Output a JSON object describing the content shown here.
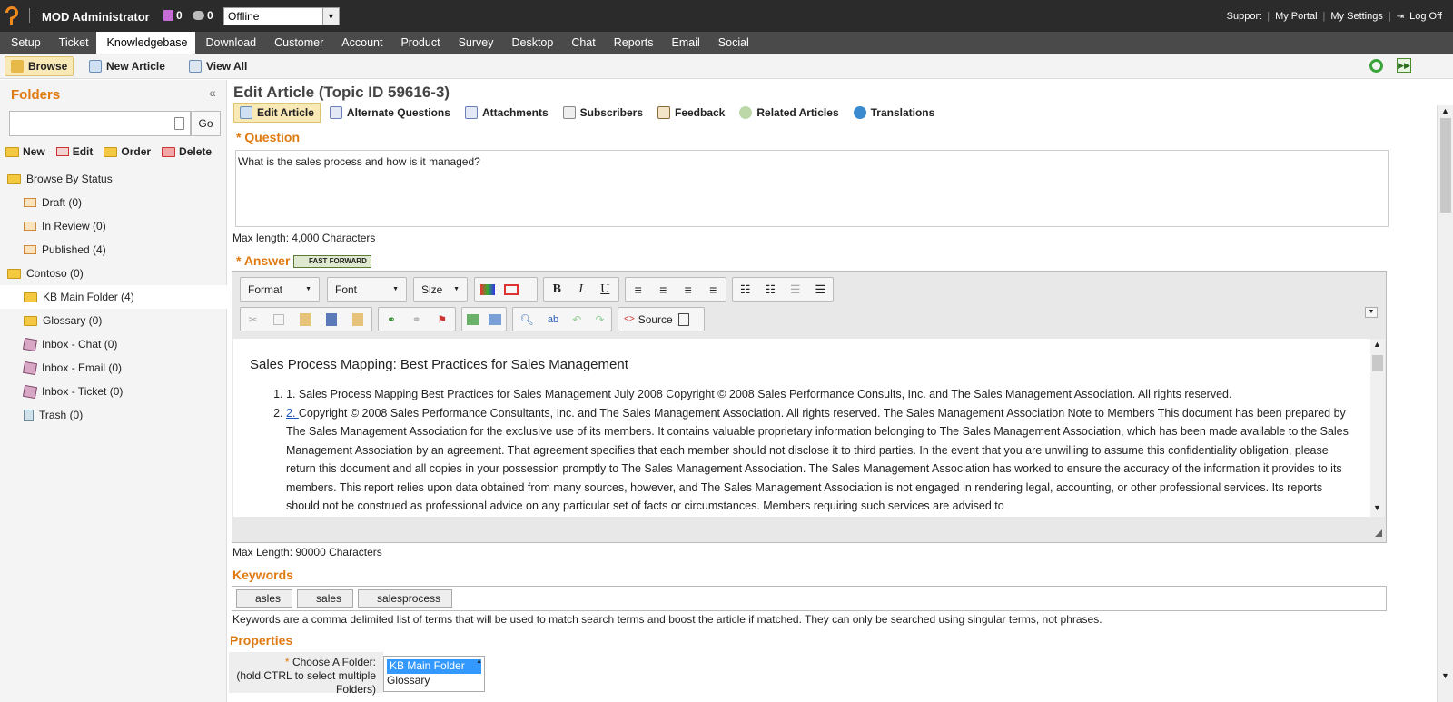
{
  "topbar": {
    "user": "MOD Administrator",
    "count1": "0",
    "count2": "0",
    "status": "Offline",
    "links": [
      "Support",
      "My Portal",
      "My Settings",
      "Log Off"
    ]
  },
  "nav": [
    "Setup",
    "Ticket",
    "Knowledgebase",
    "Download",
    "Customer",
    "Account",
    "Product",
    "Survey",
    "Desktop",
    "Chat",
    "Reports",
    "Email",
    "Social"
  ],
  "subbar": {
    "browse": "Browse",
    "new_article": "New Article",
    "view_all": "View All"
  },
  "sidebar": {
    "title": "Folders",
    "go": "Go",
    "actions": [
      "New",
      "Edit",
      "Order",
      "Delete"
    ],
    "tree": [
      {
        "label": "Browse By Status",
        "indent": 0,
        "icon": "folder"
      },
      {
        "label": "Draft (0)",
        "indent": 1,
        "icon": "doc"
      },
      {
        "label": "In Review (0)",
        "indent": 1,
        "icon": "doc"
      },
      {
        "label": "Published (4)",
        "indent": 1,
        "icon": "doc"
      },
      {
        "label": "Contoso (0)",
        "indent": 0,
        "icon": "folder"
      },
      {
        "label": "KB Main Folder (4)",
        "indent": 1,
        "icon": "folder"
      },
      {
        "label": "Glossary (0)",
        "indent": 1,
        "icon": "folder"
      },
      {
        "label": "Inbox - Chat (0)",
        "indent": 1,
        "icon": "box"
      },
      {
        "label": "Inbox - Email (0)",
        "indent": 1,
        "icon": "box"
      },
      {
        "label": "Inbox - Ticket (0)",
        "indent": 1,
        "icon": "box"
      },
      {
        "label": "Trash (0)",
        "indent": 1,
        "icon": "bin"
      }
    ]
  },
  "page": {
    "title": "Edit Article (Topic ID 59616-3)",
    "tabs": [
      "Edit Article",
      "Alternate Questions",
      "Attachments",
      "Subscribers",
      "Feedback",
      "Related Articles",
      "Translations"
    ],
    "question_label": "* Question",
    "question_value": "What is the sales process and how is it managed?",
    "question_max": "Max length: 4,000 Characters",
    "answer_label": "* Answer",
    "fast_forward": "FAST FORWARD",
    "editor": {
      "format": "Format",
      "font": "Font",
      "size": "Size",
      "source": "Source",
      "doc_title": "Sales Process Mapping: Best Practices for Sales Management",
      "item1": "1. Sales Process Mapping Best Practices for Sales Management July 2008 Copyright © 2008 Sales Performance Consults, Inc. and The Sales Management Association. All rights reserved.",
      "item2_link": "2. ",
      "item2": "Copyright © 2008 Sales Performance Consultants, Inc. and The Sales Management Association. All rights reserved. The Sales Management Association Note to Members This document has been prepared by The Sales Management Association for the exclusive use of its members. It contains valuable proprietary information belonging to The Sales Management Association, which has been made available to the Sales Management Association by an agreement. That agreement specifies that each member should not disclose it to third parties. In the event that you are unwilling to assume this confidentiality obligation, please return this document and all copies in your possession promptly to The Sales Management Association. The Sales Management Association has worked to ensure the accuracy of the information it provides to its members. This report relies upon data obtained from many sources, however, and The Sales Management Association is not engaged in rendering legal, accounting, or other professional services. Its reports should not be construed as professional advice on any particular set of facts or circumstances. Members requiring such services are advised to"
    },
    "answer_max": "Max Length: 90000 Characters",
    "keywords_label": "Keywords",
    "keywords": [
      "asles",
      "sales",
      "salesprocess"
    ],
    "keywords_hint": "Keywords are a comma delimited list of terms that will be used to match search terms and boost the article if matched. They can only be searched using singular terms, not phrases.",
    "properties_label": "Properties",
    "choose_folder_star": "*",
    "choose_folder_label": "Choose A Folder:",
    "choose_folder_hint": "(hold CTRL to select multiple Folders)",
    "folder_options": [
      "KB Main Folder",
      "Glossary"
    ]
  }
}
